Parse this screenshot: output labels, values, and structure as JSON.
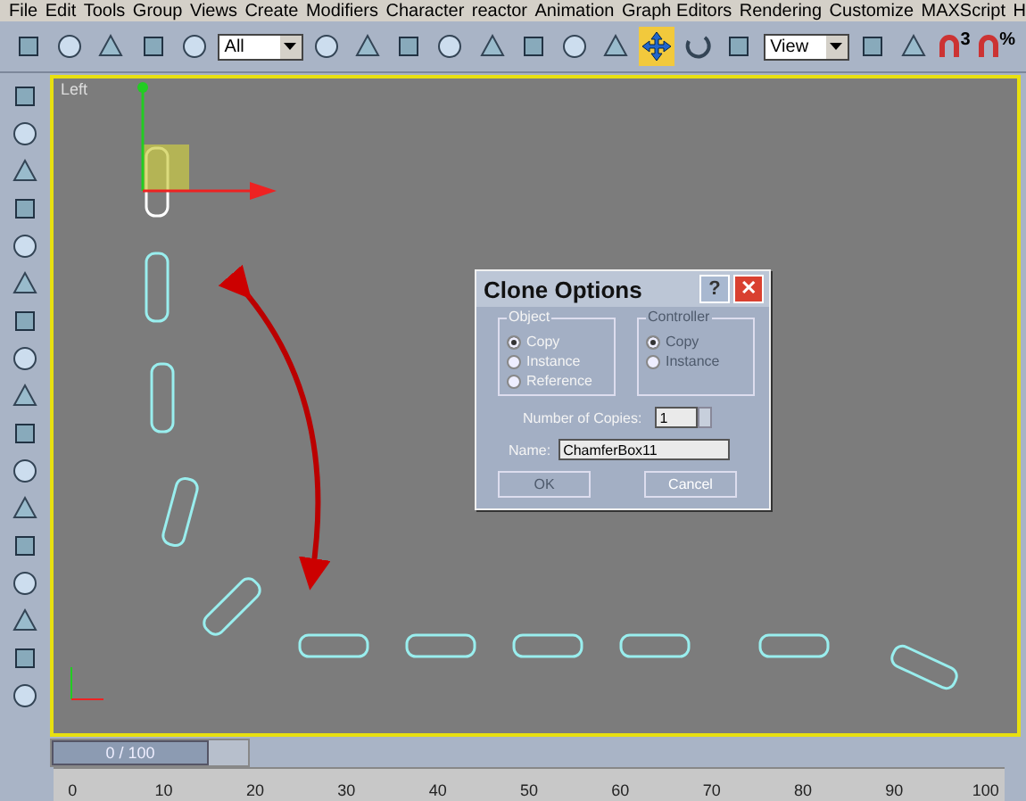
{
  "menu": [
    "File",
    "Edit",
    "Tools",
    "Group",
    "Views",
    "Create",
    "Modifiers",
    "Character",
    "reactor",
    "Animation",
    "Graph Editors",
    "Rendering",
    "Customize",
    "MAXScript",
    "H"
  ],
  "toolbar": {
    "selection_filter": "All",
    "coordinate_system": "View",
    "snap_labels": [
      "3",
      "%"
    ]
  },
  "viewport": {
    "label": "Left"
  },
  "dialog": {
    "title": "Clone Options",
    "help_glyph": "?",
    "close_glyph": "✕",
    "object_group": {
      "title": "Object",
      "options": [
        {
          "label": "Copy",
          "selected": true
        },
        {
          "label": "Instance",
          "selected": false
        },
        {
          "label": "Reference",
          "selected": false
        }
      ]
    },
    "controller_group": {
      "title": "Controller",
      "disabled": true,
      "options": [
        {
          "label": "Copy",
          "selected": true
        },
        {
          "label": "Instance",
          "selected": false
        }
      ]
    },
    "copies_label": "Number of Copies:",
    "copies_value": "1",
    "name_label": "Name:",
    "name_value": "ChamferBox11",
    "buttons": [
      {
        "label": "OK",
        "disabled": true
      },
      {
        "label": "Cancel",
        "disabled": false
      }
    ]
  },
  "time_slider": {
    "label": "0 / 100",
    "level": 0
  },
  "ruler": [
    "0",
    "10",
    "20",
    "30",
    "40",
    "50",
    "60",
    "70",
    "80",
    "90",
    "100"
  ]
}
